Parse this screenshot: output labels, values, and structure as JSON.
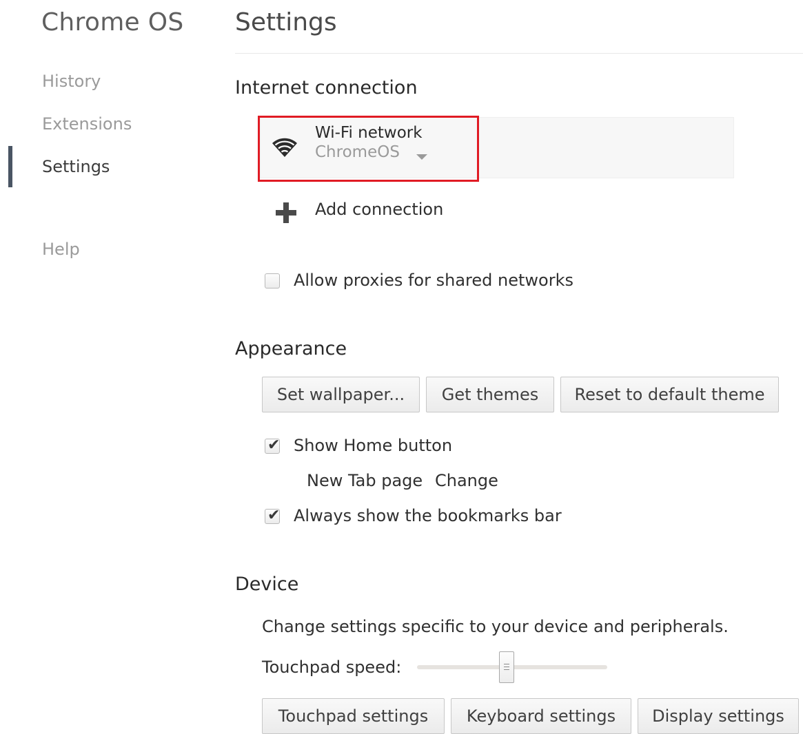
{
  "sidebar": {
    "brand": "Chrome OS",
    "items": [
      {
        "label": "History"
      },
      {
        "label": "Extensions"
      },
      {
        "label": "Settings"
      },
      {
        "label": "Help"
      }
    ],
    "active_item": "Settings"
  },
  "header": {
    "title": "Settings"
  },
  "internet": {
    "title": "Internet connection",
    "network": {
      "type_label": "Wi-Fi network",
      "ssid": "ChromeOS",
      "icon": "wifi-icon"
    },
    "add_connection_label": "Add connection",
    "allow_proxies": {
      "label": "Allow proxies for shared networks",
      "checked": false
    }
  },
  "appearance": {
    "title": "Appearance",
    "buttons": {
      "set_wallpaper": "Set wallpaper...",
      "get_themes": "Get themes",
      "reset_theme": "Reset to default theme"
    },
    "show_home_button": {
      "label": "Show Home button",
      "checked": true
    },
    "new_tab_page": {
      "label": "New Tab page",
      "change_link": "Change"
    },
    "bookmarks_bar": {
      "label": "Always show the bookmarks bar",
      "checked": true
    }
  },
  "device": {
    "title": "Device",
    "description": "Change settings specific to your device and peripherals.",
    "touchpad_speed": {
      "label": "Touchpad speed:",
      "level": 0.47
    },
    "buttons": {
      "touchpad": "Touchpad settings",
      "keyboard": "Keyboard settings",
      "display": "Display settings"
    }
  },
  "colors": {
    "accent_link": "#3a77d8",
    "highlight": "#e01b24",
    "nav_indicator": "#4a5564"
  }
}
